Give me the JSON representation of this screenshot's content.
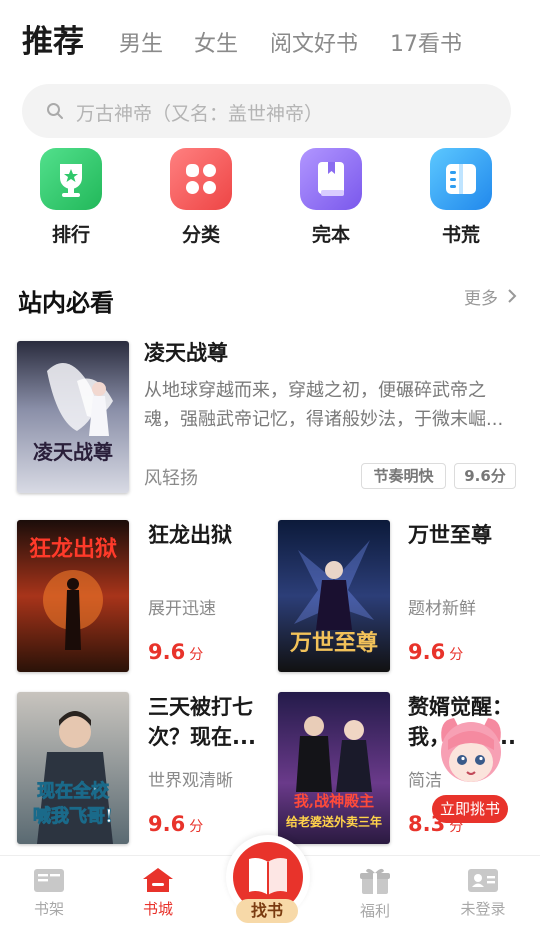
{
  "top_tabs": [
    {
      "label": "推荐",
      "active": true
    },
    {
      "label": "男生"
    },
    {
      "label": "女生"
    },
    {
      "label": "阅文好书"
    },
    {
      "label": "17看书"
    }
  ],
  "search": {
    "placeholder": "万古神帝（又名：盖世神帝）",
    "icon": "search-icon"
  },
  "categories": [
    {
      "label": "排行",
      "icon": "trophy-icon",
      "color": "#2fc86a"
    },
    {
      "label": "分类",
      "icon": "grid-icon",
      "color": "#f25a5a"
    },
    {
      "label": "完本",
      "icon": "book-bookmark-icon",
      "color": "#8a6cf0"
    },
    {
      "label": "书荒",
      "icon": "open-book-icon",
      "color": "#2f9df0"
    }
  ],
  "section": {
    "title": "站内必看",
    "more": "更多"
  },
  "featured": {
    "title": "凌天战尊",
    "desc_line1": "从地球穿越而来，穿越之初，便碾碎武帝之",
    "desc_line2": "魂，强融武帝记忆，得诸般妙法，于微末崛...",
    "author": "风轻扬",
    "tag": "节奏明快",
    "score_tag": "9.6分",
    "cover_text": "凌天战尊"
  },
  "books": [
    {
      "title": "狂龙出狱",
      "sub": "展开迅速",
      "score": "9.6",
      "unit": "分",
      "cover_text": "狂龙出狱"
    },
    {
      "title": "万世至尊",
      "sub": "题材新鲜",
      "score": "9.6",
      "unit": "分",
      "cover_text": "万世至尊"
    },
    {
      "title_line1": "三天被打七",
      "title_line2": "次？现在...",
      "sub": "世界观清晰",
      "score": "9.6",
      "unit": "分",
      "cover_text_1": "现在全校",
      "cover_text_2": "喊我飞哥!"
    },
    {
      "title_line1": "赘婿觉醒：",
      "title_line2": "我，战神...",
      "sub": "简洁",
      "score": "8.3",
      "unit": "分",
      "cover_text_1": "我,战神殿主",
      "cover_text_2": "给老婆送外卖三年"
    }
  ],
  "float_badge": {
    "label": "立即挑书"
  },
  "bottom_nav": [
    {
      "label": "书架",
      "icon": "bookshelf-icon"
    },
    {
      "label": "书城",
      "icon": "store-home-icon",
      "active": true
    },
    {
      "label": "找书",
      "icon": "find-book-icon"
    },
    {
      "label": "福利",
      "icon": "gift-icon"
    },
    {
      "label": "未登录",
      "icon": "profile-card-icon"
    }
  ],
  "colors": {
    "accent": "#e8332b",
    "text": "#1a1a1a",
    "muted": "#8a8a8a"
  }
}
